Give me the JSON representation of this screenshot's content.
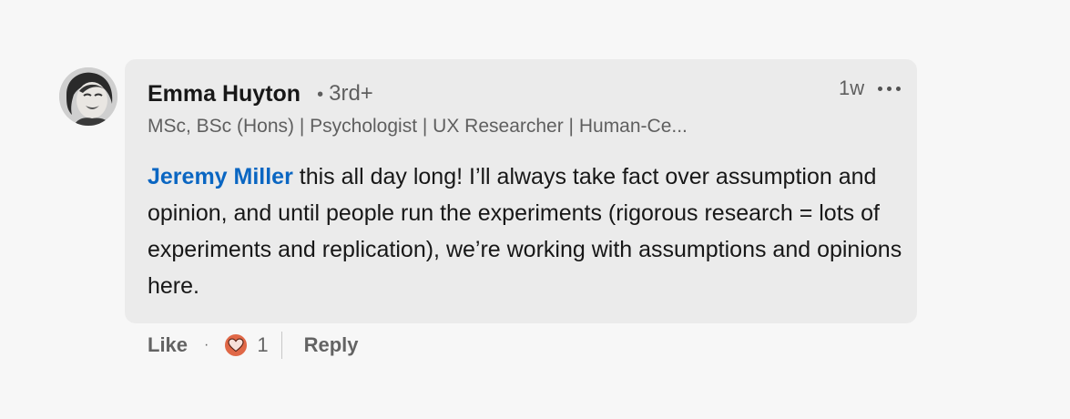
{
  "comment": {
    "author_name": "Emma Huyton",
    "degree": "3rd+",
    "degree_separator": "•",
    "headline": "MSc, BSc (Hons) | Psychologist | UX Researcher | Human-Ce...",
    "timestamp": "1w",
    "mention": "Jeremy Miller",
    "body": " this all day long! I’ll always take fact over assumption and opinion, and until people run the experiments (rigorous research = lots of experiments and replication), we’re working with assumptions and opinions here."
  },
  "actions": {
    "like_label": "Like",
    "separator": "·",
    "reaction_icon": "heart-icon",
    "reaction_count": "1",
    "reply_label": "Reply"
  },
  "colors": {
    "mention": "#0a66c2",
    "reaction": "#e06847",
    "bubble": "#ebebeb",
    "background": "#f7f7f7"
  }
}
